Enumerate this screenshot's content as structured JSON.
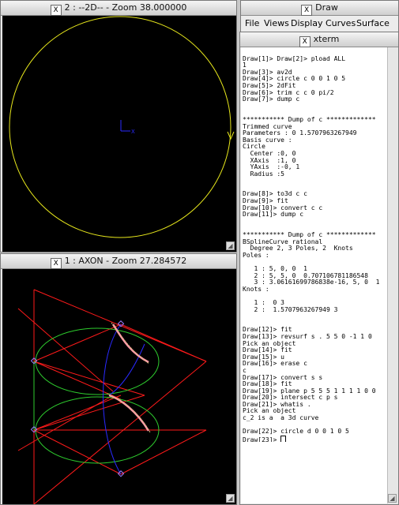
{
  "win2d": {
    "title": "2 : --2D-- - Zoom 38.000000",
    "axis_x_label": "X"
  },
  "axon": {
    "title": "1 : AXON - Zoom 27.284572"
  },
  "draw": {
    "title": "Draw",
    "menus": [
      "File",
      "Views",
      "Display",
      "Curves",
      "Surface"
    ]
  },
  "xterm": {
    "title": "xterm",
    "lines": [
      "",
      "Draw[1]> Draw[2]> pload ALL",
      "1",
      "Draw[3]> av2d",
      "Draw[4]> circle c 0 0 1 0 5",
      "Draw[5]> 2dFit",
      "Draw[6]> trim c c 0 pi/2",
      "Draw[7]> dump c",
      "",
      "",
      "*********** Dump of c *************",
      "Trimmed curve",
      "Parameters : 0 1.5707963267949",
      "Basis curve :",
      "Circle",
      "  Center :0, 0",
      "  XAxis  :1, 0",
      "  YAxis  :-0, 1",
      "  Radius :5",
      "",
      "",
      "Draw[8]> to3d c c",
      "Draw[9]> fit",
      "Draw[10]> convert c c",
      "Draw[11]> dump c",
      "",
      "",
      "*********** Dump of c *************",
      "BSplineCurve rational",
      "  Degree 2, 3 Poles, 2  Knots",
      "Poles :",
      "",
      "   1 : 5, 0, 0  1",
      "   2 : 5, 5, 0  0.707106781186548",
      "   3 : 3.06161699786838e-16, 5, 0  1",
      "Knots :",
      "",
      "   1 :  0 3",
      "   2 :  1.5707963267949 3",
      "",
      "",
      "Draw[12]> fit",
      "Draw[13]> revsurf s . 5 5 0 -1 1 0",
      "Pick an object",
      "Draw[14]> fit",
      "Draw[15]> u",
      "Draw[16]> erase c",
      "c",
      "Draw[17]> convert s s",
      "Draw[18]> fit",
      "Draw[19]> plane p 5 5 5 1 1 1 1 0 0",
      "Draw[20]> intersect c p s",
      "Draw[21]> whatis .",
      "Pick an object",
      "c_2 is a  a 3d curve",
      "",
      "Draw[22]> circle d 0 0 1 0 5",
      "Draw[23]> "
    ]
  },
  "colors": {
    "yellow": "#e8e81c",
    "red": "#ff1a1a",
    "green": "#2ecc2e",
    "blue": "#2a2aff",
    "pink": "#ff9aa8",
    "tan": "#d6c27a"
  }
}
